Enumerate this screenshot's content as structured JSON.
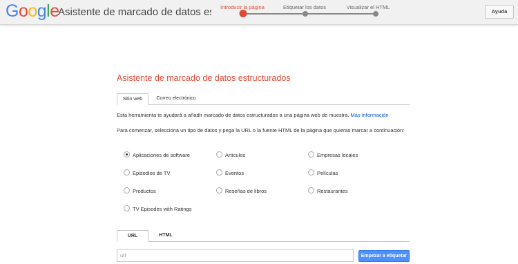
{
  "header": {
    "logo_letters": [
      {
        "ch": "G",
        "color": "#4285f4"
      },
      {
        "ch": "o",
        "color": "#ea4335"
      },
      {
        "ch": "o",
        "color": "#fbbc05"
      },
      {
        "ch": "g",
        "color": "#4285f4"
      },
      {
        "ch": "l",
        "color": "#34a853"
      },
      {
        "ch": "e",
        "color": "#ea4335"
      }
    ],
    "app_title": "Asistente de marcado de datos estructurados",
    "steps": [
      {
        "label": "Introducir la página",
        "active": true
      },
      {
        "label": "Etiquetar los datos",
        "active": false
      },
      {
        "label": "Visualizar el HTML",
        "active": false
      }
    ],
    "help_label": "Ayuda"
  },
  "main": {
    "heading": "Asistente de marcado de datos estructurados",
    "tabs": [
      {
        "label": "Sitio web",
        "selected": true
      },
      {
        "label": "Correo electrónico",
        "selected": false
      }
    ],
    "description": "Esta herramienta te ayudará a añadir marcado de datos estructurados a una página web de muestra.",
    "more_info_link": "Más información",
    "instructions": "Para comenzar, selecciona un tipo de datos y pega la URL o la fuente HTML de la página que quieras marcar a continuación:",
    "data_types": [
      {
        "label": "Aplicaciones de software",
        "checked": true
      },
      {
        "label": "Artículos",
        "checked": false
      },
      {
        "label": "Empresas locales",
        "checked": false
      },
      {
        "label": "Episodios de TV",
        "checked": false
      },
      {
        "label": "Eventos",
        "checked": false
      },
      {
        "label": "Películas",
        "checked": false
      },
      {
        "label": "Productos",
        "checked": false
      },
      {
        "label": "Reseñas de libros",
        "checked": false
      },
      {
        "label": "Restaurantes",
        "checked": false
      },
      {
        "label": "TV Episodes with Ratings",
        "checked": false
      }
    ],
    "source_tabs": [
      {
        "label": "URL",
        "selected": true
      },
      {
        "label": "HTML",
        "selected": false
      }
    ],
    "url_placeholder": "url",
    "start_button": "Empezar a etiquetar"
  },
  "colors": {
    "accent": "#dd4b39",
    "link": "#1155cc",
    "primary_button": "#4d90fe"
  }
}
